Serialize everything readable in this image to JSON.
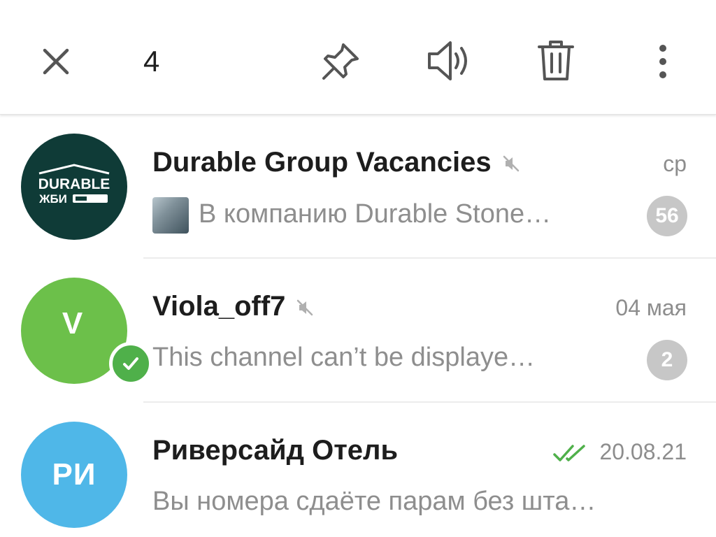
{
  "toolbar": {
    "selected_count": "4",
    "icons": [
      "close-icon",
      "pin-icon",
      "mute-icon",
      "trash-icon",
      "more-vertical-icon"
    ]
  },
  "chats": [
    {
      "title": "Durable Group Vacancies",
      "time": "ср",
      "preview": "В компанию Durable Stone…",
      "unread": "56",
      "muted": true,
      "avatar": {
        "line1": "DURABLE",
        "line2": "ЖБИ",
        "bg": "#0f3b37"
      }
    },
    {
      "title": "Viola_off7",
      "time": "04 мая",
      "preview": "This channel can’t be displaye…",
      "unread": "2",
      "muted": true,
      "avatar": {
        "initials": "V",
        "bg": "#6cc04a"
      },
      "selected": true
    },
    {
      "title": "Риверсайд Отель",
      "time": "20.08.21",
      "preview": "Вы номера сдаёте парам без шта…",
      "read_status": "double-check",
      "avatar": {
        "initials": "РИ",
        "bg": "#4fb7e8"
      }
    }
  ],
  "colors": {
    "badge_muted": "#c7c7c7",
    "check_green": "#4fb04a",
    "text_secondary": "#8e8e8e"
  }
}
